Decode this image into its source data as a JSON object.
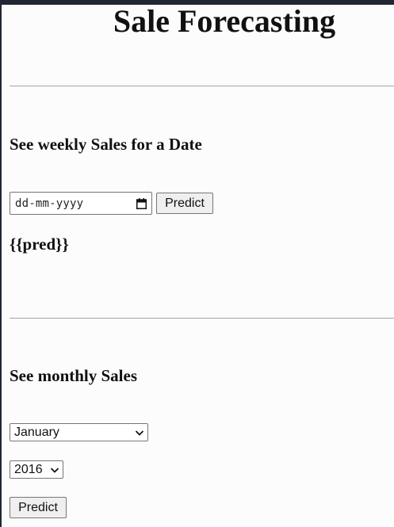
{
  "page": {
    "title": "Sale Forecasting"
  },
  "weekly": {
    "heading": "See weekly Sales for a Date",
    "date_placeholder": "dd-mm-yyyy",
    "predict_label": "Predict",
    "prediction_text": "{{pred}}"
  },
  "monthly": {
    "heading": "See monthly Sales",
    "month_selected": "January",
    "year_selected": "2016",
    "predict_label": "Predict"
  },
  "colors": {
    "top_bar": "#202733",
    "background": "#fcfcfc",
    "rule": "#a6a6a6",
    "button_bg": "#efefef",
    "control_border": "#767676"
  },
  "icons": {
    "date_picker": "calendar-icon",
    "select_arrow": "chevron-down-icon"
  }
}
